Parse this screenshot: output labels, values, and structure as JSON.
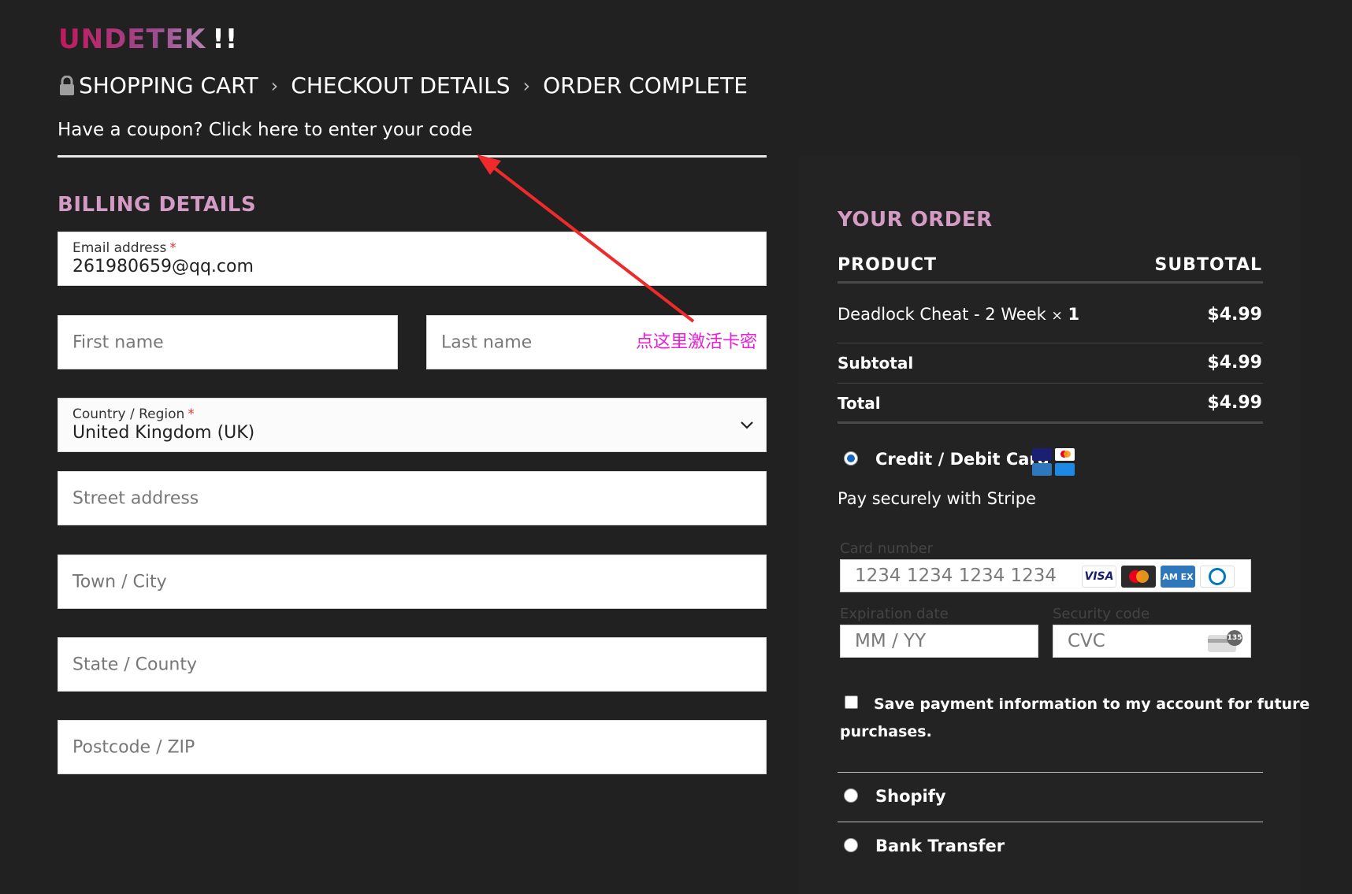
{
  "logo": {
    "text": "UNDETEK",
    "suffix": "!!"
  },
  "steps": {
    "cart": "SHOPPING CART",
    "checkout": "CHECKOUT DETAILS",
    "complete": "ORDER COMPLETE"
  },
  "coupon": {
    "text": "Have a coupon? Click here to enter your code"
  },
  "annotation": {
    "text": "点这里激活卡密"
  },
  "billing": {
    "title": "BILLING DETAILS",
    "email": {
      "label": "Email address",
      "required": "*",
      "value": "261980659@qq.com"
    },
    "first_name": {
      "placeholder": "First name"
    },
    "last_name": {
      "placeholder": "Last name"
    },
    "country": {
      "label": "Country / Region",
      "required": "*",
      "value": "United Kingdom (UK)"
    },
    "street": {
      "placeholder": "Street address"
    },
    "city": {
      "placeholder": "Town / City"
    },
    "state": {
      "placeholder": "State / County"
    },
    "postcode": {
      "placeholder": "Postcode / ZIP"
    }
  },
  "order": {
    "title": "YOUR ORDER",
    "col_product": "PRODUCT",
    "col_subtotal": "SUBTOTAL",
    "item_name": "Deadlock Cheat - 2 Week",
    "item_qty_sign": "×",
    "item_qty": "1",
    "item_price": "$4.99",
    "subtotal_label": "Subtotal",
    "subtotal_value": "$4.99",
    "total_label": "Total",
    "total_value": "$4.99"
  },
  "payment": {
    "card_label": "Credit / Debit Card",
    "stripe_text": "Pay securely with Stripe",
    "card_number_label": "Card number",
    "card_number_placeholder": "1234 1234 1234 1234",
    "expiry_label": "Expiration date",
    "expiry_placeholder": "MM / YY",
    "cvc_label": "Security code",
    "cvc_placeholder": "CVC",
    "cvc_badge": "135",
    "brands": {
      "visa": "VISA",
      "amex": "AM EX"
    },
    "save_text_1": "Save payment information to my account for future",
    "save_text_2": "purchases.",
    "shopify_label": "Shopify",
    "bank_label": "Bank Transfer"
  },
  "colors": {
    "background": "#212121",
    "accent": "#d49bc4",
    "annotation": "#e91ed8",
    "radio_selected": "#1565c0"
  }
}
